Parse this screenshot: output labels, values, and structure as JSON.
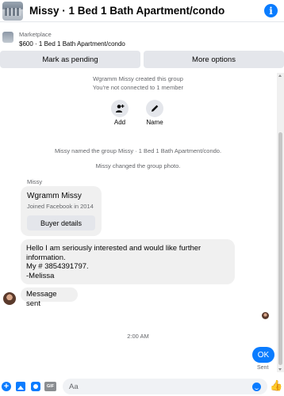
{
  "header": {
    "title": "Missy · 1 Bed 1 Bath Apartment/condo",
    "info_icon": "i"
  },
  "marketplace": {
    "label": "Marketplace",
    "listing": "$600 · 1 Bed 1 Bath Apartment/condo"
  },
  "actions": {
    "mark_pending": "Mark as pending",
    "more_options": "More options"
  },
  "conversation": {
    "created_text": "Wgramm Missy created this group",
    "connected_text": "You're not connected to 1 member",
    "add_label": "Add",
    "name_label": "Name",
    "named_group_text": "Missy named the group Missy · 1 Bed 1 Bath Apartment/condo.",
    "changed_photo_text": "Missy changed the group photo.",
    "sender_name": "Missy",
    "profile_card": {
      "name": "Wgramm Missy",
      "joined": "Joined Facebook in 2014",
      "buyer_details": "Buyer details"
    },
    "messages": [
      {
        "lines": [
          "Hello I am seriously interested and would like further",
          "information.",
          "My # 3854391797.",
          "-Melissa"
        ]
      },
      {
        "text": "Message sent"
      }
    ],
    "timestamp": "2:00 AM",
    "outgoing": {
      "text": "OK",
      "status": "Sent"
    }
  },
  "composer": {
    "placeholder": "Aa",
    "gif_label": "GIF",
    "plus_icon": "+",
    "like_icon": "👍"
  },
  "colors": {
    "accent": "#0a7cff",
    "bubble": "#f0f0f0",
    "button": "#e4e6eb",
    "muted_text": "#65676b"
  },
  "icons": [
    "info-icon",
    "add-member-icon",
    "edit-name-icon",
    "plus-icon",
    "photo-icon",
    "sticker-icon",
    "gif-icon",
    "emoji-icon",
    "like-icon"
  ]
}
